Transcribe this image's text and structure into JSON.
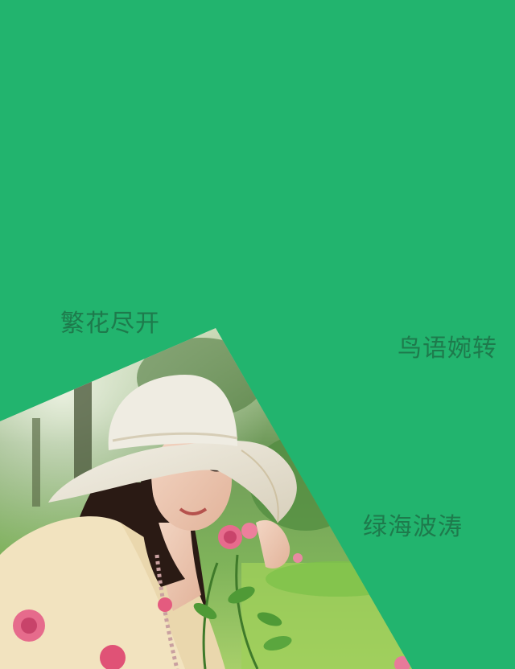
{
  "colors": {
    "background": "#22B46E",
    "caption_text": "#1E7A4C"
  },
  "photo": {
    "subject": "woman-in-sun-hat-smelling-roses"
  },
  "captions": [
    "繁花尽开",
    "鸟语婉转",
    "绿海波涛"
  ]
}
